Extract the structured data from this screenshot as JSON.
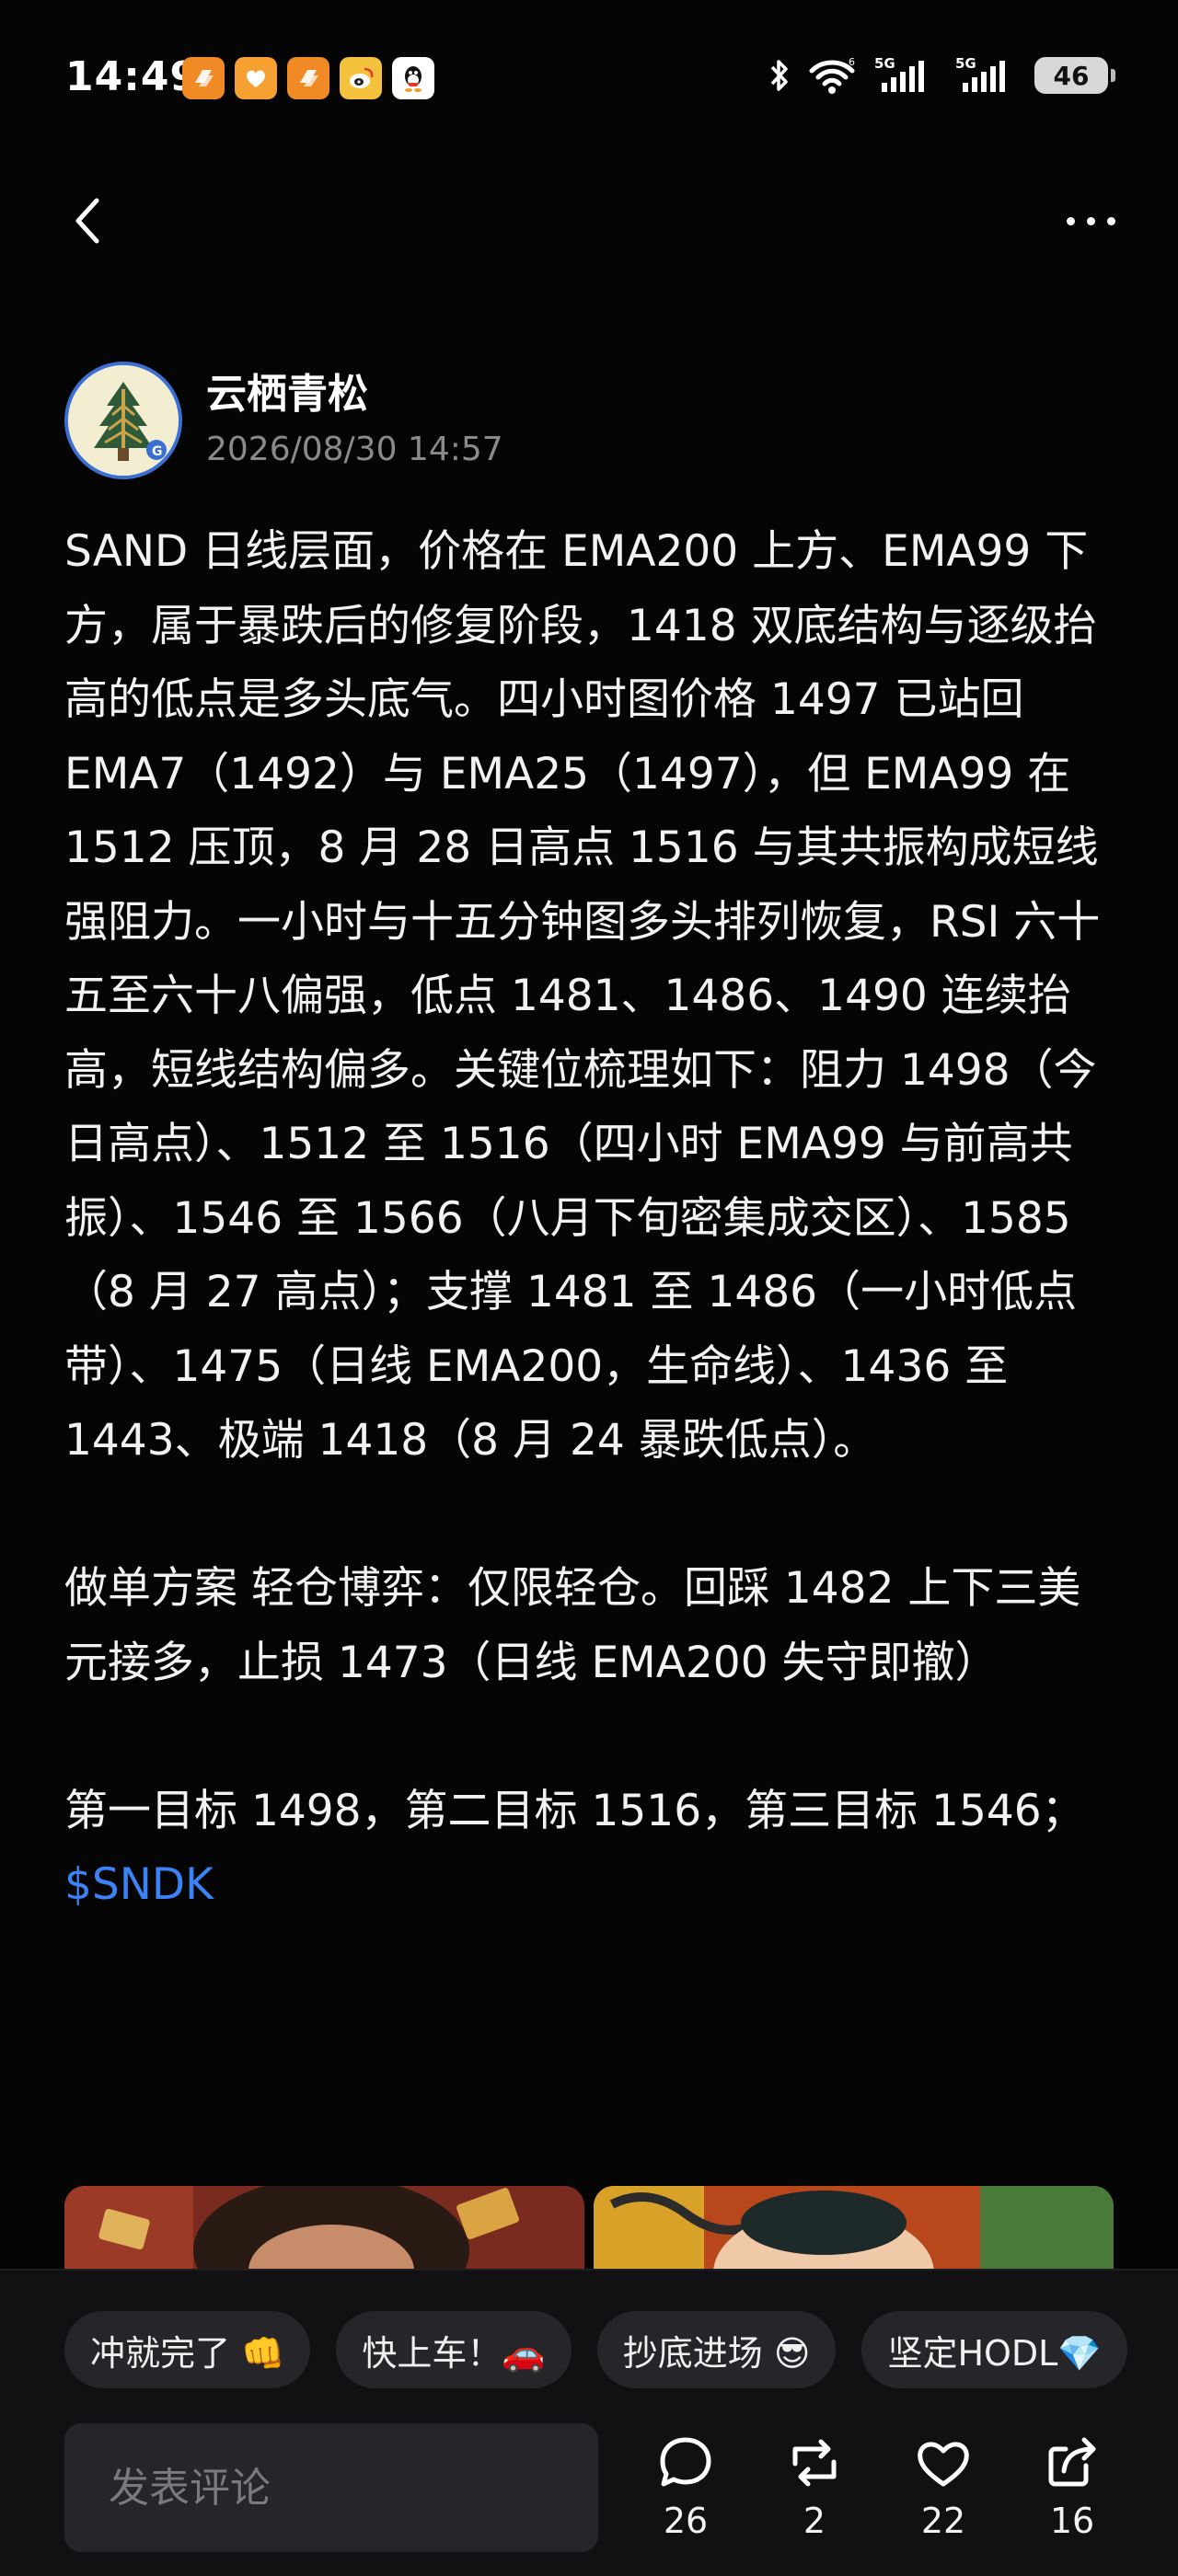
{
  "status_bar": {
    "time": "14:49",
    "battery": "46",
    "network": "5G"
  },
  "author": {
    "name": "云栖青松",
    "time": "2026/08/30 14:57"
  },
  "post": {
    "paragraph_1": "SAND 日线层面，价格在 EMA200 上方、EMA99 下方，属于暴跌后的修复阶段，1418 双底结构与逐级抬高的低点是多头底气。四小时图价格 1497 已站回 EMA7（1492）与 EMA25（1497），但 EMA99 在 1512 压顶，8 月 28 日高点 1516 与其共振构成短线强阻力。一小时与十五分钟图多头排列恢复，RSI 六十五至六十八偏强，低点 1481、1486、1490 连续抬高，短线结构偏多。关键位梳理如下：阻力 1498（今日高点）、1512 至 1516（四小时 EMA99 与前高共振）、1546 至 1566（八月下旬密集成交区）、1585（8 月 27 高点）；支撑 1481 至 1486（一小时低点带）、1475（日线 EMA200，生命线）、1436 至 1443、极端 1418（8 月 24 暴跌低点）。",
    "paragraph_2": "做单方案 轻仓博弈：仅限轻仓。回踩 1482 上下三美元接多，止损 1473（日线 EMA200 失守即撤）",
    "paragraph_3": "第一目标 1498，第二目标 1516，第三目标 1546；",
    "ticker": "$SNDK"
  },
  "quick_replies": [
    "冲就完了 👊",
    "快上车！🚗",
    "抄底进场 😎",
    "坚定HODL💎"
  ],
  "comment": {
    "placeholder": "发表评论"
  },
  "actions": {
    "comments": "26",
    "reposts": "2",
    "likes": "22",
    "shares": "16"
  },
  "colors": {
    "background": "#050505",
    "accent": "#3b82f6",
    "panel": "#111113",
    "chip": "#26262a"
  }
}
